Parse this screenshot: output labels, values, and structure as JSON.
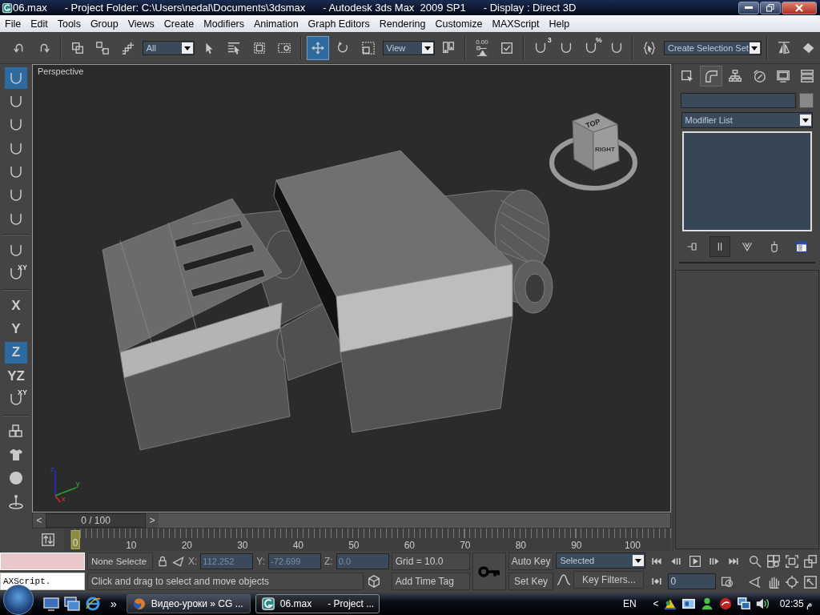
{
  "window": {
    "title": [
      "06.max",
      "- Project Folder: C:\\Users\\nedal\\Documents\\3dsmax",
      "- Autodesk 3ds Max  2009 SP1",
      "- Display : Direct 3D"
    ]
  },
  "menu": [
    "File",
    "Edit",
    "Tools",
    "Group",
    "Views",
    "Create",
    "Modifiers",
    "Animation",
    "Graph Editors",
    "Rendering",
    "Customize",
    "MAXScript",
    "Help"
  ],
  "toolbar": [
    {
      "kind": "button",
      "selected": false
    },
    {
      "kind": "button",
      "selected": false
    },
    {
      "kind": "separator"
    },
    {
      "kind": "button",
      "selected": false
    },
    {
      "kind": "button",
      "selected": false
    },
    {
      "kind": "button",
      "selected": false
    },
    {
      "kind": "dropdown",
      "value": "All"
    },
    {
      "kind": "button",
      "selected": false
    },
    {
      "kind": "button",
      "selected": false
    },
    {
      "kind": "button",
      "selected": false
    },
    {
      "kind": "button",
      "selected": false
    },
    {
      "kind": "separator"
    },
    {
      "kind": "button",
      "selected": true
    },
    {
      "kind": "button",
      "selected": false
    },
    {
      "kind": "button",
      "selected": false
    },
    {
      "kind": "dropdown",
      "value": "View"
    },
    {
      "kind": "button",
      "selected": false
    },
    {
      "kind": "separator"
    },
    {
      "kind": "button",
      "selected": false,
      "label": "0.00"
    },
    {
      "kind": "button",
      "selected": false
    },
    {
      "kind": "separator"
    },
    {
      "kind": "button",
      "selected": false,
      "badge": "3"
    },
    {
      "kind": "button",
      "selected": false
    },
    {
      "kind": "button",
      "selected": false,
      "badge": "%"
    },
    {
      "kind": "button",
      "selected": false
    },
    {
      "kind": "separator"
    },
    {
      "kind": "button",
      "selected": false
    },
    {
      "kind": "dropdown",
      "value": "Create Selection Set"
    },
    {
      "kind": "separator"
    },
    {
      "kind": "button",
      "selected": false
    },
    {
      "kind": "button",
      "selected": false
    }
  ],
  "left_toolbar": [
    {
      "kind": "button",
      "selected": true
    },
    {
      "kind": "button",
      "selected": false
    },
    {
      "kind": "button",
      "selected": false
    },
    {
      "kind": "button",
      "selected": false
    },
    {
      "kind": "button",
      "selected": false
    },
    {
      "kind": "button",
      "selected": false
    },
    {
      "kind": "button",
      "selected": false
    },
    {
      "kind": "separator"
    },
    {
      "kind": "button",
      "selected": false
    },
    {
      "kind": "button",
      "selected": false,
      "badge": "XY"
    },
    {
      "kind": "separator"
    },
    {
      "kind": "button",
      "selected": false,
      "label": "X"
    },
    {
      "kind": "button",
      "selected": false,
      "label": "Y"
    },
    {
      "kind": "button",
      "selected": true,
      "label": "Z"
    },
    {
      "kind": "button",
      "selected": false,
      "label": "YZ"
    },
    {
      "kind": "button",
      "selected": false,
      "badge": "XY"
    },
    {
      "kind": "separator"
    },
    {
      "kind": "button",
      "selected": false
    },
    {
      "kind": "button",
      "selected": false
    },
    {
      "kind": "button",
      "selected": false
    },
    {
      "kind": "button",
      "selected": false
    }
  ],
  "viewport": {
    "label": "Perspective",
    "view_cube": [
      "TOP",
      "RIGHT"
    ],
    "axes": [
      "z",
      "y",
      "x"
    ]
  },
  "command_panel": {
    "tabs": [
      {
        "selected": false
      },
      {
        "selected": true
      },
      {
        "selected": false
      },
      {
        "selected": false
      },
      {
        "selected": false
      },
      {
        "selected": false
      }
    ],
    "modifier_list": "Modifier List",
    "stack_buttons": [
      {
        "on": false
      },
      {
        "on": true
      },
      {
        "on": false
      },
      {
        "on": false
      },
      {
        "on": false
      }
    ]
  },
  "timeline": {
    "prev": "<",
    "slider": "0 / 100",
    "level": 0,
    "next": ">",
    "ruler": [
      "0",
      "10",
      "20",
      "30",
      "40",
      "50",
      "60",
      "70",
      "80",
      "90",
      "100"
    ]
  },
  "status": {
    "listener_input": "AXScript.",
    "selection": "None Selecte",
    "coords": [
      {
        "axis": "X:",
        "value": "112.252"
      },
      {
        "axis": "Y:",
        "value": "-72.699"
      },
      {
        "axis": "Z:",
        "value": "0.0"
      }
    ],
    "grid": "Grid = 10.0",
    "prompt": "Click and drag to select and move objects",
    "time_tag": "Add Time Tag"
  },
  "animation": {
    "auto_key": "Auto Key",
    "key_set": "Selected",
    "set_key": "Set Key",
    "key_filters": "Key Filters...",
    "frame": "0"
  },
  "taskbar": {
    "more": "»",
    "tasks": [
      {
        "label": "Видео-уроки » CG ...",
        "selected": false
      },
      {
        "label": "06.max      - Project ...",
        "selected": true
      }
    ],
    "language": "EN",
    "tray_expand": "<",
    "clock": "02:35 م"
  }
}
